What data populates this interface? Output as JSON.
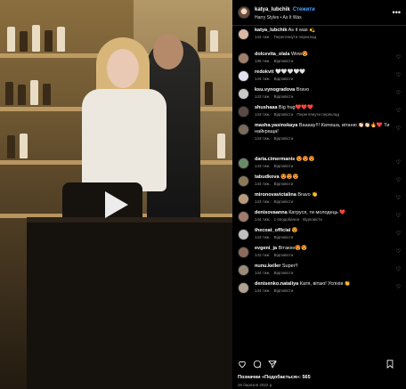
{
  "header": {
    "username": "katya_lubchik",
    "follow_label": "Стежити",
    "song": "Harry Styles • As It Was"
  },
  "comments": [
    {
      "user": "katya_lubchik",
      "text": "As it was 💫",
      "time": "144 тиж.",
      "actions": [
        "Переглянути переклад"
      ],
      "avatar_color": "#d9b7a3",
      "heart": false
    },
    {
      "user": "dolcevita_olala",
      "text": "Wow😍",
      "time": "136 тиж.",
      "actions": [
        "Відповісти"
      ],
      "avatar_color": "#a0806a",
      "heart": true
    },
    {
      "user": "redokvit",
      "text": "🤍🤍🤍🤍🤍",
      "time": "144 тиж.",
      "actions": [
        "Відповісти"
      ],
      "avatar_color": "#e0e0f0",
      "heart": true
    },
    {
      "user": "ksu.vynogradova",
      "text": "Bravo",
      "time": "143 тиж.",
      "actions": [
        "Відповісти"
      ],
      "avatar_color": "#c8c8c8",
      "heart": true
    },
    {
      "user": "shushaaa",
      "text": "Big hug❤️❤️❤️",
      "time": "143 тиж.",
      "actions": [
        "Відповісти",
        "Переглянути переклад"
      ],
      "avatar_color": "#5a4a44",
      "heart": true
    },
    {
      "user": "masha.yasinskaya",
      "text": "Вааааy!!! Катюша, вітаню 👏🏻👏🏻🔥❤️ Ти найкраща!",
      "time": "143 тиж.",
      "actions": [
        "Відповісти"
      ],
      "avatar_color": "#7a6a5a",
      "heart": true
    },
    {
      "user": "daria.cimermanis",
      "text": "😍😍😍",
      "time": "143 тиж.",
      "actions": [
        "Відповісти"
      ],
      "avatar_color": "#6a8a6a",
      "heart": true
    },
    {
      "user": "tabudkova",
      "text": "😍😍😍",
      "time": "144 тиж.",
      "actions": [
        "Відповісти"
      ],
      "avatar_color": "#8a7a5a",
      "heart": true
    },
    {
      "user": "mironovavictalina",
      "text": "Bravo 👏",
      "time": "143 тиж.",
      "actions": [
        "Відповісти"
      ],
      "avatar_color": "#b89a7a",
      "heart": true
    },
    {
      "user": "denisovaanna",
      "text": "Катруся, ти молодець ❤️",
      "time": "144 тиж.",
      "actions": [
        "1 вподобання",
        "Відповісти"
      ],
      "avatar_color": "#a07a6a",
      "heart": true
    },
    {
      "user": "thecoat_official",
      "text": "😍",
      "time": "143 тиж.",
      "actions": [
        "Відповісти"
      ],
      "avatar_color": "#c0c0c0",
      "heart": true
    },
    {
      "user": "evgeni_ja",
      "text": "Вітаюю😍😍",
      "time": "143 тиж.",
      "actions": [
        "Відповісти"
      ],
      "avatar_color": "#8a6a5a",
      "heart": true
    },
    {
      "user": "nunu.keller",
      "text": "Super!!",
      "time": "144 тиж.",
      "actions": [
        "Відповісти"
      ],
      "avatar_color": "#9a8a7a",
      "heart": true
    },
    {
      "user": "denisenko.nataliya",
      "text": "Катя, вітаю! Успіхів 👏",
      "time": "144 тиж.",
      "actions": [
        "Відповісти"
      ],
      "avatar_color": "#b0a090",
      "heart": true
    }
  ],
  "footer": {
    "likes": "Позначки «Подобається»: 565",
    "date": "26 березня 2022 р."
  },
  "icons": [
    "more-icon",
    "play-icon",
    "heart-icon",
    "comment-icon",
    "share-icon",
    "bookmark-icon"
  ],
  "colors": {
    "follow": "#4aa3ff",
    "panel_bg": "#000000"
  }
}
